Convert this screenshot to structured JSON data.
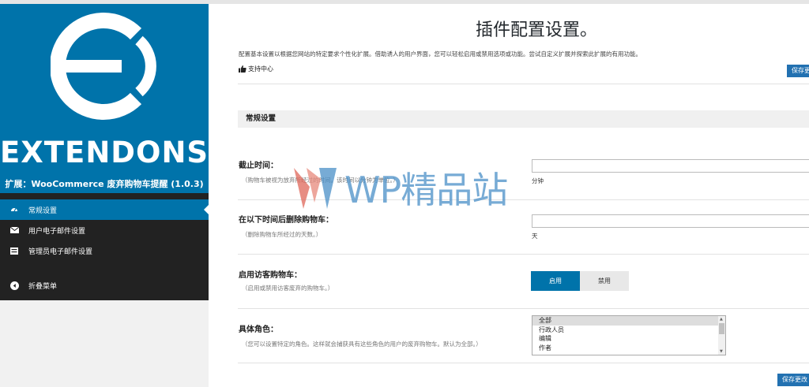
{
  "sidebar": {
    "brand": "EXTENDONS",
    "plugin_title": "扩展：WooCommerce 废弃购物车提醒 (1.0.3)",
    "items": [
      {
        "label": "常规设置",
        "icon": "gauge-icon",
        "active": true
      },
      {
        "label": "用户电子邮件设置",
        "icon": "envelope-icon"
      },
      {
        "label": "管理员电子邮件设置",
        "icon": "inbox-icon"
      },
      {
        "label": "折叠菜单",
        "icon": "collapse-arrow-icon"
      }
    ]
  },
  "main": {
    "title": "插件配置设置。",
    "description": "配置基本设置以根据您网站的特定要求个性化扩展。借助诱人的用户界面，您可以轻松启用或禁用选项或功能。尝试自定义扩展并探索此扩展的有用功能。",
    "support_label": "支持中心",
    "save_top_label": "保存更改",
    "save_bottom_label": "保存更改",
    "section_title": "常规设置",
    "fields": {
      "cutoff": {
        "label": "截止时间：",
        "help": "（购物车被视为放弃所经过的时间。该时间以分钟为单位。）",
        "value": "",
        "unit": "分钟"
      },
      "delete_after": {
        "label": "在以下时间后删除购物车：",
        "help": "（删除购物车所经过的天数。）",
        "value": "",
        "unit": "天"
      },
      "guest_cart": {
        "label": "启用访客购物车：",
        "help": "（启用或禁用访客废弃的购物车。）",
        "on_label": "启用",
        "off_label": "禁用"
      },
      "roles": {
        "label": "具体角色：",
        "help": "（您可以设置特定的角色。这样就会捕获具有这些角色的用户的废弃购物车。默认为全部。）",
        "options": [
          "全部",
          "行政人员",
          "编辑",
          "作者"
        ]
      }
    }
  },
  "watermark": {
    "text": "WP精品站"
  },
  "colors": {
    "accent": "#0073aa",
    "sidebar_bg": "#222222",
    "button": "#2271b1"
  }
}
